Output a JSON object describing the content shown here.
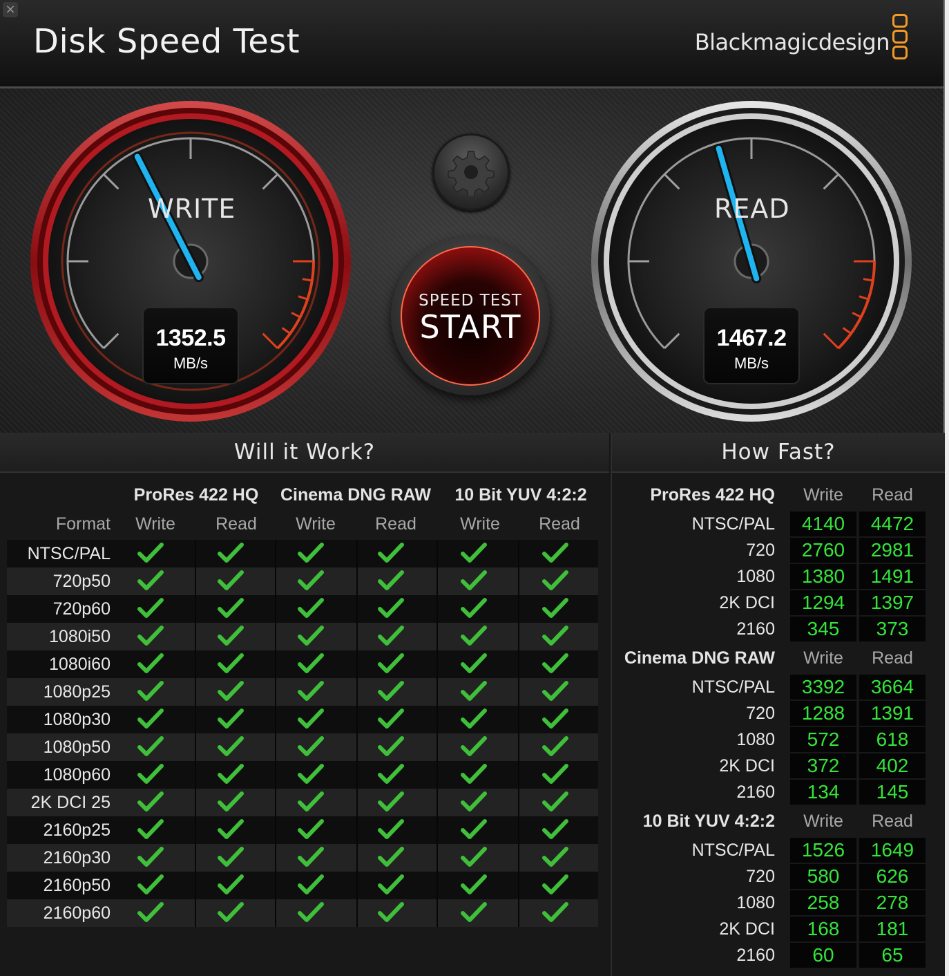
{
  "window": {
    "title": "Disk Speed Test",
    "brand": "Blackmagicdesign",
    "close_symbol": "×"
  },
  "gauges": {
    "write": {
      "label": "WRITE",
      "value": "1352.5",
      "unit": "MB/s",
      "needle_fraction": 0.4
    },
    "read": {
      "label": "READ",
      "value": "1467.2",
      "unit": "MB/s",
      "needle_fraction": 0.44
    }
  },
  "start_button": {
    "small": "SPEED TEST",
    "big": "START"
  },
  "will_it_work": {
    "title": "Will it Work?",
    "format_header": "Format",
    "groups": [
      "ProRes 422 HQ",
      "Cinema DNG RAW",
      "10 Bit YUV 4:2:2"
    ],
    "write_label": "Write",
    "read_label": "Read",
    "rows": [
      "NTSC/PAL",
      "720p50",
      "720p60",
      "1080i50",
      "1080i60",
      "1080p25",
      "1080p30",
      "1080p50",
      "1080p60",
      "2K DCI 25",
      "2160p25",
      "2160p30",
      "2160p50",
      "2160p60"
    ],
    "check_color": "#3fbf3a"
  },
  "how_fast": {
    "title": "How Fast?",
    "write_label": "Write",
    "read_label": "Read",
    "groups": [
      {
        "name": "ProRes 422 HQ",
        "rows": [
          {
            "label": "NTSC/PAL",
            "write": "4140",
            "read": "4472"
          },
          {
            "label": "720",
            "write": "2760",
            "read": "2981"
          },
          {
            "label": "1080",
            "write": "1380",
            "read": "1491"
          },
          {
            "label": "2K DCI",
            "write": "1294",
            "read": "1397"
          },
          {
            "label": "2160",
            "write": "345",
            "read": "373"
          }
        ]
      },
      {
        "name": "Cinema DNG RAW",
        "rows": [
          {
            "label": "NTSC/PAL",
            "write": "3392",
            "read": "3664"
          },
          {
            "label": "720",
            "write": "1288",
            "read": "1391"
          },
          {
            "label": "1080",
            "write": "572",
            "read": "618"
          },
          {
            "label": "2K DCI",
            "write": "372",
            "read": "402"
          },
          {
            "label": "2160",
            "write": "134",
            "read": "145"
          }
        ]
      },
      {
        "name": "10 Bit YUV 4:2:2",
        "rows": [
          {
            "label": "NTSC/PAL",
            "write": "1526",
            "read": "1649"
          },
          {
            "label": "720",
            "write": "580",
            "read": "626"
          },
          {
            "label": "1080",
            "write": "258",
            "read": "278"
          },
          {
            "label": "2K DCI",
            "write": "168",
            "read": "181"
          },
          {
            "label": "2160",
            "write": "60",
            "read": "65"
          }
        ]
      }
    ]
  },
  "colors": {
    "accent_orange": "#f39b27",
    "value_green": "#35e43a",
    "needle_blue": "#1fb4f0",
    "write_ring": "#a8141c"
  }
}
